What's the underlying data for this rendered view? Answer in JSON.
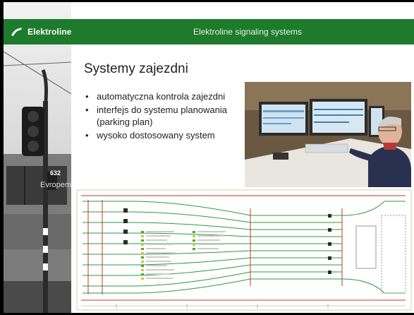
{
  "header": {
    "brand": "Elektroline",
    "title": "Elektroline signaling systems"
  },
  "content": {
    "title": "Systemy zajezdni",
    "bullets": [
      "automatyczna kontrola zajezdni",
      "interfejs do systemu planowania (parking plan)",
      "wysoko dostosowany system"
    ]
  },
  "left_photo": {
    "route_number": "632",
    "destination": "Evropem"
  },
  "colors": {
    "header_green": "#1e7a2c",
    "track_green": "#2f9a3b",
    "track_red": "#c0392b"
  },
  "icons": {
    "logo": "swoosh-logo-icon",
    "bullet": "bullet-dot"
  }
}
